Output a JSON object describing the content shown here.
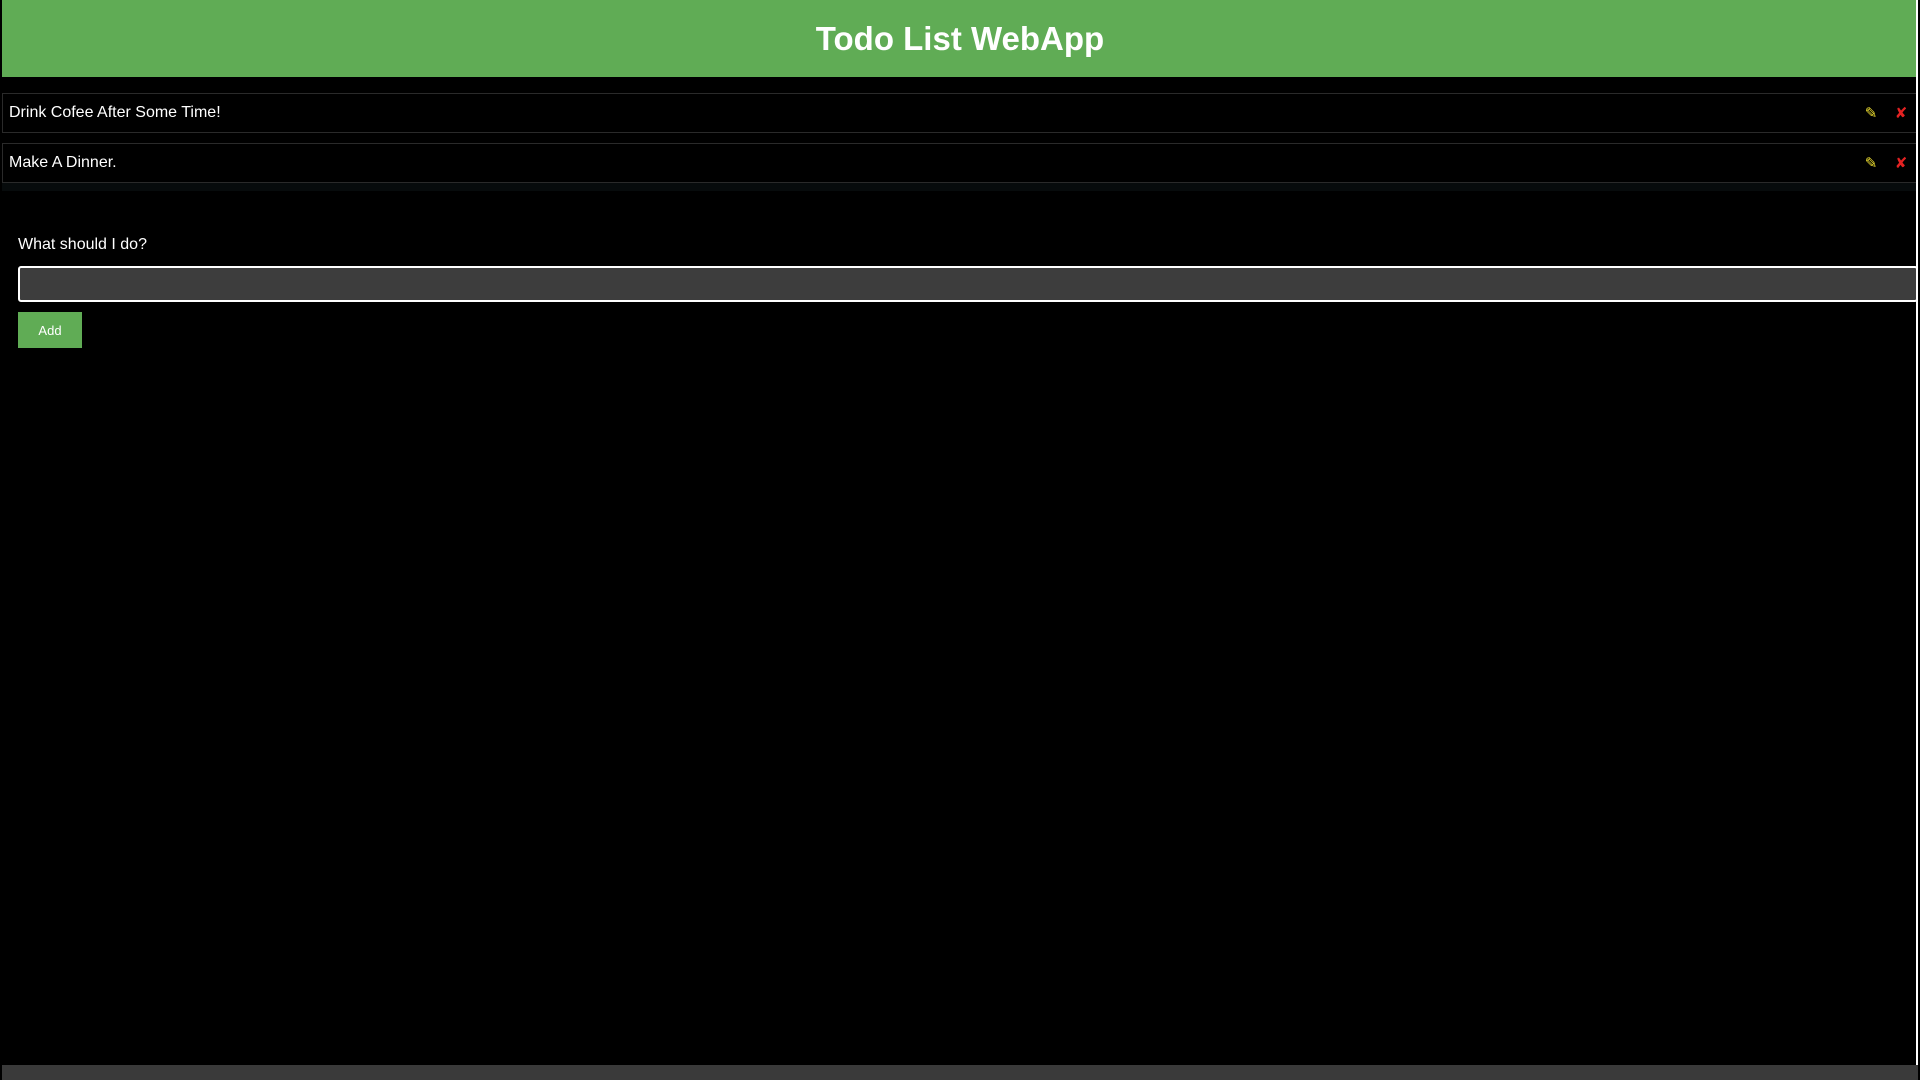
{
  "app": {
    "title": "Todo List WebApp"
  },
  "todos": [
    {
      "text": "Drink Cofee After Some Time!",
      "edit_icon": "pencil-icon",
      "delete_icon": "cross-icon"
    },
    {
      "text": "Make A Dinner.",
      "edit_icon": "pencil-icon",
      "delete_icon": "cross-icon"
    }
  ],
  "icons": {
    "edit_glyph": "✎",
    "delete_glyph": "✘"
  },
  "form": {
    "label": "What should I do?",
    "input_value": "",
    "input_placeholder": "",
    "add_label": "Add"
  },
  "colors": {
    "brand_green": "#60ac55",
    "edit_yellow": "#f0e030",
    "delete_red": "#e32222",
    "background": "#000000",
    "input_bg": "#3d3d3d"
  }
}
